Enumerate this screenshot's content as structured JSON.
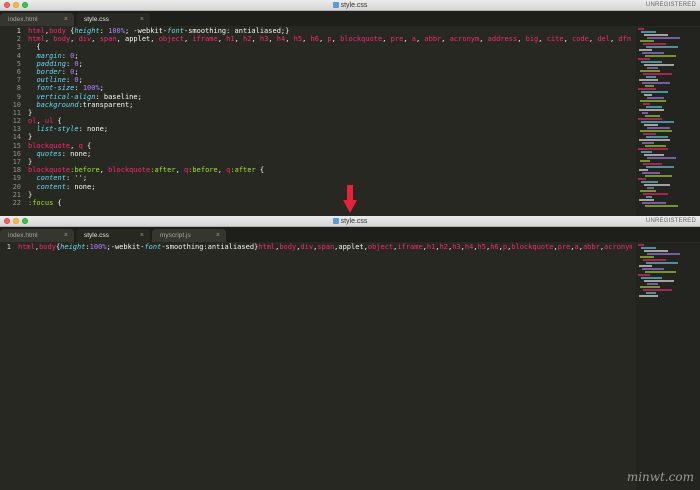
{
  "top_window": {
    "title": "style.css",
    "unregistered": "UNREGISTERED",
    "tabs": [
      {
        "label": "index.html",
        "active": false
      },
      {
        "label": "style.css",
        "active": true
      }
    ],
    "lines": [
      [
        [
          "t-tag",
          "html"
        ],
        [
          "t-plain",
          ","
        ],
        [
          "t-tag",
          "body"
        ],
        [
          "t-plain",
          " {"
        ],
        [
          "t-prop",
          "height"
        ],
        [
          "t-plain",
          ": "
        ],
        [
          "t-num",
          "100%"
        ],
        [
          "t-plain",
          "; -webkit-"
        ],
        [
          "t-prop",
          "font"
        ],
        [
          "t-plain",
          "-smoothing: antialiased;}"
        ]
      ],
      [
        [
          "t-tag",
          "html"
        ],
        [
          "t-plain",
          ", "
        ],
        [
          "t-tag",
          "body"
        ],
        [
          "t-plain",
          ", "
        ],
        [
          "t-tag",
          "div"
        ],
        [
          "t-plain",
          ", "
        ],
        [
          "t-tag",
          "span"
        ],
        [
          "t-plain",
          ", applet, "
        ],
        [
          "t-tag",
          "object"
        ],
        [
          "t-plain",
          ", "
        ],
        [
          "t-tag",
          "iframe"
        ],
        [
          "t-plain",
          ", "
        ],
        [
          "t-tag",
          "h1"
        ],
        [
          "t-plain",
          ", "
        ],
        [
          "t-tag",
          "h2"
        ],
        [
          "t-plain",
          ", "
        ],
        [
          "t-tag",
          "h3"
        ],
        [
          "t-plain",
          ", "
        ],
        [
          "t-tag",
          "h4"
        ],
        [
          "t-plain",
          ", "
        ],
        [
          "t-tag",
          "h5"
        ],
        [
          "t-plain",
          ", "
        ],
        [
          "t-tag",
          "h6"
        ],
        [
          "t-plain",
          ", "
        ],
        [
          "t-tag",
          "p"
        ],
        [
          "t-plain",
          ", "
        ],
        [
          "t-tag",
          "blockquote"
        ],
        [
          "t-plain",
          ", "
        ],
        [
          "t-tag",
          "pre"
        ],
        [
          "t-plain",
          ", "
        ],
        [
          "t-tag",
          "a"
        ],
        [
          "t-plain",
          ", "
        ],
        [
          "t-tag",
          "abbr"
        ],
        [
          "t-plain",
          ", "
        ],
        [
          "t-tag",
          "acronym"
        ],
        [
          "t-plain",
          ", "
        ],
        [
          "t-tag",
          "address"
        ],
        [
          "t-plain",
          ", "
        ],
        [
          "t-tag",
          "big"
        ],
        [
          "t-plain",
          ", "
        ],
        [
          "t-tag",
          "cite"
        ],
        [
          "t-plain",
          ", "
        ],
        [
          "t-tag",
          "code"
        ],
        [
          "t-plain",
          ", "
        ],
        [
          "t-tag",
          "del"
        ],
        [
          "t-plain",
          ", "
        ],
        [
          "t-tag",
          "dfn"
        ],
        [
          "t-plain",
          ","
        ]
      ],
      [
        [
          "t-plain",
          "  {"
        ]
      ],
      [
        [
          "t-plain",
          "  "
        ],
        [
          "t-prop",
          "margin"
        ],
        [
          "t-plain",
          ": "
        ],
        [
          "t-num",
          "0"
        ],
        [
          "t-plain",
          ";"
        ]
      ],
      [
        [
          "t-plain",
          "  "
        ],
        [
          "t-prop",
          "padding"
        ],
        [
          "t-plain",
          ": "
        ],
        [
          "t-num",
          "0"
        ],
        [
          "t-plain",
          ";"
        ]
      ],
      [
        [
          "t-plain",
          "  "
        ],
        [
          "t-prop",
          "border"
        ],
        [
          "t-plain",
          ": "
        ],
        [
          "t-num",
          "0"
        ],
        [
          "t-plain",
          ";"
        ]
      ],
      [
        [
          "t-plain",
          "  "
        ],
        [
          "t-prop",
          "outline"
        ],
        [
          "t-plain",
          ": "
        ],
        [
          "t-num",
          "0"
        ],
        [
          "t-plain",
          ";"
        ]
      ],
      [
        [
          "t-plain",
          "  "
        ],
        [
          "t-prop",
          "font-size"
        ],
        [
          "t-plain",
          ": "
        ],
        [
          "t-num",
          "100%"
        ],
        [
          "t-plain",
          ";"
        ]
      ],
      [
        [
          "t-plain",
          "  "
        ],
        [
          "t-prop",
          "vertical-align"
        ],
        [
          "t-plain",
          ": baseline;"
        ]
      ],
      [
        [
          "t-plain",
          "  "
        ],
        [
          "t-prop",
          "background"
        ],
        [
          "t-plain",
          ":transparent;"
        ]
      ],
      [
        [
          "t-plain",
          "}"
        ]
      ],
      [
        [
          "t-tag",
          "ol"
        ],
        [
          "t-plain",
          ", "
        ],
        [
          "t-tag",
          "ul"
        ],
        [
          "t-plain",
          " {"
        ]
      ],
      [
        [
          "t-plain",
          "  "
        ],
        [
          "t-prop",
          "list-style"
        ],
        [
          "t-plain",
          ": none;"
        ]
      ],
      [
        [
          "t-plain",
          "}"
        ]
      ],
      [
        [
          "t-tag",
          "blockquote"
        ],
        [
          "t-plain",
          ", "
        ],
        [
          "t-tag",
          "q"
        ],
        [
          "t-plain",
          " {"
        ]
      ],
      [
        [
          "t-plain",
          "  "
        ],
        [
          "t-prop",
          "quotes"
        ],
        [
          "t-plain",
          ": none;"
        ]
      ],
      [
        [
          "t-plain",
          "}"
        ]
      ],
      [
        [
          "t-tag",
          "blockquote"
        ],
        [
          "t-pseudo",
          ":before"
        ],
        [
          "t-plain",
          ", "
        ],
        [
          "t-tag",
          "blockquote"
        ],
        [
          "t-pseudo",
          ":after"
        ],
        [
          "t-plain",
          ", "
        ],
        [
          "t-tag",
          "q"
        ],
        [
          "t-pseudo",
          ":before"
        ],
        [
          "t-plain",
          ", "
        ],
        [
          "t-tag",
          "q"
        ],
        [
          "t-pseudo",
          ":after"
        ],
        [
          "t-plain",
          " {"
        ]
      ],
      [
        [
          "t-plain",
          "  "
        ],
        [
          "t-prop",
          "content"
        ],
        [
          "t-plain",
          ": "
        ],
        [
          "t-str",
          "''"
        ],
        [
          "t-plain",
          ";"
        ]
      ],
      [
        [
          "t-plain",
          "  "
        ],
        [
          "t-prop",
          "content"
        ],
        [
          "t-plain",
          ": none;"
        ]
      ],
      [
        [
          "t-plain",
          "}"
        ]
      ],
      [
        [
          "t-pseudo",
          ":focus"
        ],
        [
          "t-plain",
          " {"
        ]
      ]
    ],
    "line_numbers": [
      "1",
      "2",
      "3",
      "4",
      "5",
      "6",
      "7",
      "8",
      "9",
      "10",
      "11",
      "12",
      "13",
      "14",
      "15",
      "16",
      "17",
      "18",
      "19",
      "20",
      "21",
      "22"
    ]
  },
  "bottom_window": {
    "title": "style.css",
    "unregistered": "UNREGISTERED",
    "tabs": [
      {
        "label": "index.html",
        "active": false
      },
      {
        "label": "style.css",
        "active": true
      },
      {
        "label": "myscript.js",
        "active": false
      }
    ],
    "lines": [
      [
        [
          "t-tag",
          "html"
        ],
        [
          "t-plain",
          ","
        ],
        [
          "t-tag",
          "body"
        ],
        [
          "t-plain",
          "{"
        ],
        [
          "t-prop",
          "height"
        ],
        [
          "t-plain",
          ":"
        ],
        [
          "t-num",
          "100%"
        ],
        [
          "t-plain",
          ";-webkit-"
        ],
        [
          "t-prop",
          "font"
        ],
        [
          "t-plain",
          "-smoothing:antialiased}"
        ],
        [
          "t-tag",
          "html"
        ],
        [
          "t-plain",
          ","
        ],
        [
          "t-tag",
          "body"
        ],
        [
          "t-plain",
          ","
        ],
        [
          "t-tag",
          "div"
        ],
        [
          "t-plain",
          ","
        ],
        [
          "t-tag",
          "span"
        ],
        [
          "t-plain",
          ",applet,"
        ],
        [
          "t-tag",
          "object"
        ],
        [
          "t-plain",
          ","
        ],
        [
          "t-tag",
          "iframe"
        ],
        [
          "t-plain",
          ","
        ],
        [
          "t-tag",
          "h1"
        ],
        [
          "t-plain",
          ","
        ],
        [
          "t-tag",
          "h2"
        ],
        [
          "t-plain",
          ","
        ],
        [
          "t-tag",
          "h3"
        ],
        [
          "t-plain",
          ","
        ],
        [
          "t-tag",
          "h4"
        ],
        [
          "t-plain",
          ","
        ],
        [
          "t-tag",
          "h5"
        ],
        [
          "t-plain",
          ","
        ],
        [
          "t-tag",
          "h6"
        ],
        [
          "t-plain",
          ","
        ],
        [
          "t-tag",
          "p"
        ],
        [
          "t-plain",
          ","
        ],
        [
          "t-tag",
          "blockquote"
        ],
        [
          "t-plain",
          ","
        ],
        [
          "t-tag",
          "pre"
        ],
        [
          "t-plain",
          ","
        ],
        [
          "t-tag",
          "a"
        ],
        [
          "t-plain",
          ","
        ],
        [
          "t-tag",
          "abbr"
        ],
        [
          "t-plain",
          ","
        ],
        [
          "t-tag",
          "acronym"
        ]
      ]
    ],
    "line_numbers": [
      "1"
    ]
  },
  "watermark": "minwt.com",
  "colors": {
    "editor_bg": "#272822",
    "tag": "#f92672",
    "property": "#66d9ef",
    "number": "#ae81ff",
    "string": "#e6db74",
    "arrow": "#e8213a"
  }
}
